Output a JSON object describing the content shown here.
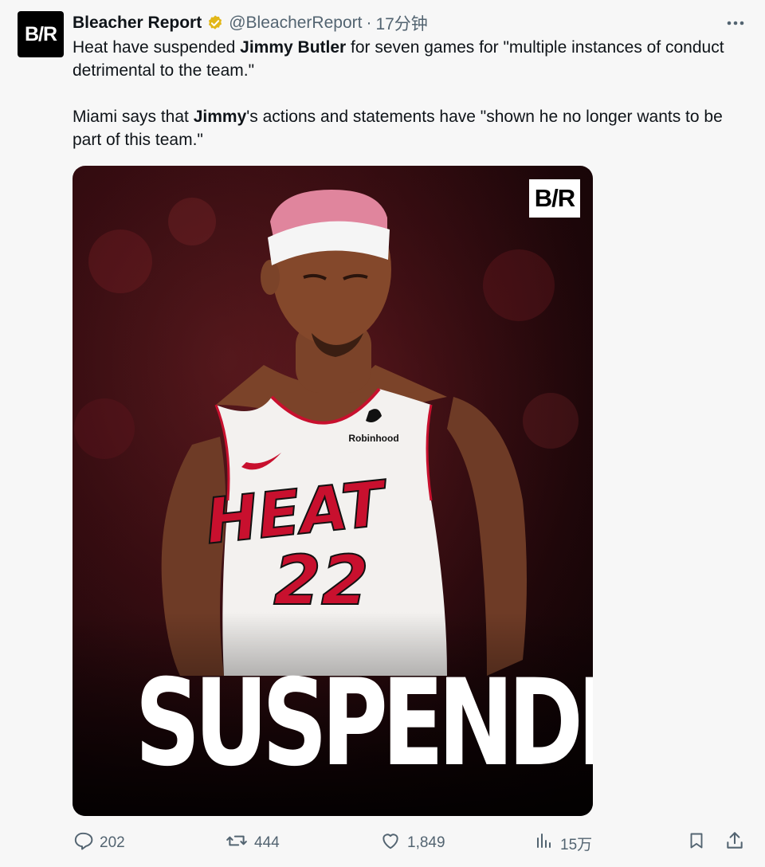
{
  "author": {
    "avatar_text": "B/R",
    "name": "Bleacher Report",
    "handle": "@BleacherReport",
    "separator": "·",
    "time": "17分钟",
    "verified_color": "#e2b719"
  },
  "tweet": {
    "p1_before": "Heat have suspended ",
    "p1_bold": "Jimmy Butler",
    "p1_after": " for seven games for \"multiple instances of conduct detrimental to the team.\"",
    "p2_before": "Miami says that ",
    "p2_bold": "Jimmy",
    "p2_after": "'s actions and statements have \"shown he no longer wants to be part of this team.\""
  },
  "media": {
    "logo_text": "B/R",
    "headline": "SUSPENDED",
    "jersey_team": "HEAT",
    "jersey_number": "22",
    "jersey_sponsor": "Robinhood"
  },
  "actions": {
    "replies": "202",
    "reposts": "444",
    "likes": "1,849",
    "views": "15万"
  },
  "colors": {
    "background": "#f7f7f7",
    "text": "#0f1419",
    "muted": "#536471",
    "heat_red": "#c8102e"
  }
}
